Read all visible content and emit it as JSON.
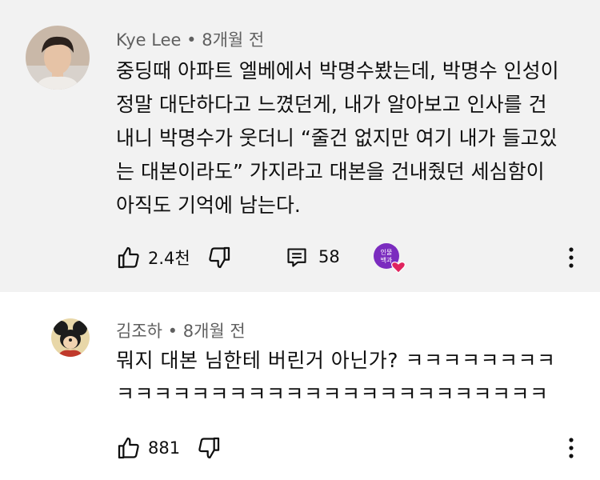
{
  "comments": [
    {
      "author": "Kye Lee",
      "separator": "•",
      "time": "8개월 전",
      "lines": [
        "중딩때 아파트 엘베에서 박명수봤는데, 박명수 인성이",
        "정말 대단하다고 느꼈던게, 내가 알아보고 인사를 건",
        "내니 박명수가 웃더니 “줄건 없지만 여기 내가 들고있",
        "는 대본이라도” 가지라고 대본을 건내줬던 세심함이",
        "아직도 기억에 남는다."
      ],
      "likes": "2.4천",
      "replies": "58",
      "creator_heart_badge_text": "인물백과",
      "icons": [
        "thumbs-up-icon",
        "thumbs-down-icon",
        "reply-icon",
        "creator-heart-icon",
        "more-vert-icon"
      ]
    },
    {
      "author": "김조하",
      "separator": "•",
      "time": "8개월 전",
      "lines": [
        "뭐지 대본 님한테 버린거 아닌가? ㅋㅋㅋㅋㅋㅋㅋㅋ",
        "ㅋㅋㅋㅋㅋㅋㅋㅋㅋㅋㅋㅋㅋㅋㅋㅋㅋㅋㅋㅋㅋㅋㅋ"
      ],
      "likes": "881",
      "icons": [
        "thumbs-up-icon",
        "thumbs-down-icon",
        "more-vert-icon"
      ]
    }
  ],
  "colors": {
    "highlight_bg": "#f2f2f2",
    "meta_text": "#606060",
    "badge_purple": "#7b2cbf",
    "heart_red": "#e0245e"
  }
}
